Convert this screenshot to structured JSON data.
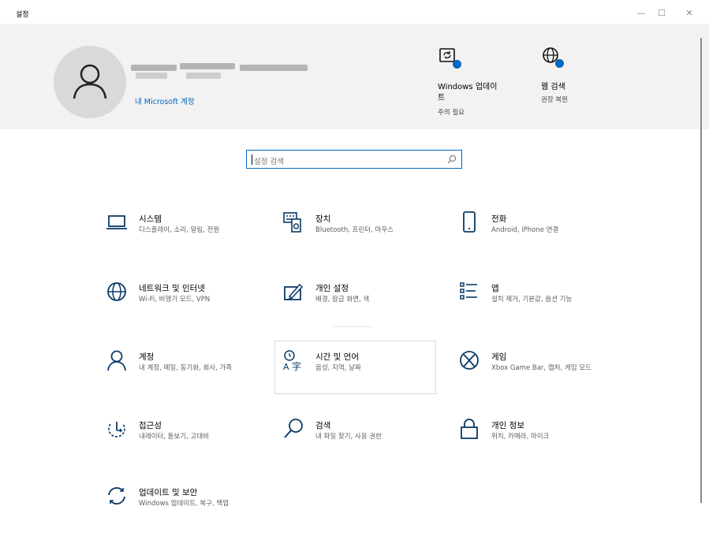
{
  "app": {
    "title": "설정"
  },
  "window_controls": {
    "minimize": "—",
    "maximize": "☐",
    "close": "✕"
  },
  "account": {
    "link": "내 Microsoft 계정"
  },
  "header_items": [
    {
      "label_line1": "Windows 업데이",
      "label_line2": "트",
      "sub": "주의 필요",
      "icon": "windows-update-icon"
    },
    {
      "label_line1": "웹 검색",
      "label_line2": "",
      "sub": "권장 복원",
      "icon": "web-search-icon"
    }
  ],
  "search": {
    "placeholder": "설정 검색"
  },
  "tiles": [
    {
      "title": "시스템",
      "sub": "디스플레이, 소리, 알림, 전원",
      "icon": "laptop-icon"
    },
    {
      "title": "장치",
      "sub": "Bluetooth, 프린터, 마우스",
      "icon": "devices-icon"
    },
    {
      "title": "전화",
      "sub": "Android, iPhone 연결",
      "icon": "phone-icon"
    },
    {
      "title": "네트워크 및 인터넷",
      "sub": "Wi-Fi, 비행기 모드, VPN",
      "icon": "globe-icon"
    },
    {
      "title": "개인 설정",
      "sub": "배경, 잠금 화면, 색",
      "icon": "personalization-icon"
    },
    {
      "title": "앱",
      "sub": "설치 제거, 기본값, 옵션 기능",
      "icon": "apps-list-icon"
    },
    {
      "title": "계정",
      "sub": "내 계정, 메일, 동기화, 회사, 가족",
      "icon": "person-icon"
    },
    {
      "title": "시간 및 언어",
      "sub": "음성, 지역, 날짜",
      "icon": "time-language-icon"
    },
    {
      "title": "게임",
      "sub": "Xbox Game Bar, 캡처, 게임 모드",
      "icon": "xbox-icon"
    },
    {
      "title": "접근성",
      "sub": "내레이터, 돋보기, 고대비",
      "icon": "accessibility-icon"
    },
    {
      "title": "검색",
      "sub": "내 파일 찾기, 사용 권한",
      "icon": "search-icon"
    },
    {
      "title": "개인 정보",
      "sub": "위치, 카메라, 마이크",
      "icon": "lock-icon"
    },
    {
      "title": "업데이트 및 보안",
      "sub": "Windows 업데이트, 복구, 백업",
      "icon": "sync-icon"
    }
  ],
  "colors": {
    "accent": "#0067c0",
    "header_bg": "#f2f2f2",
    "icon": "#0b3a66"
  }
}
